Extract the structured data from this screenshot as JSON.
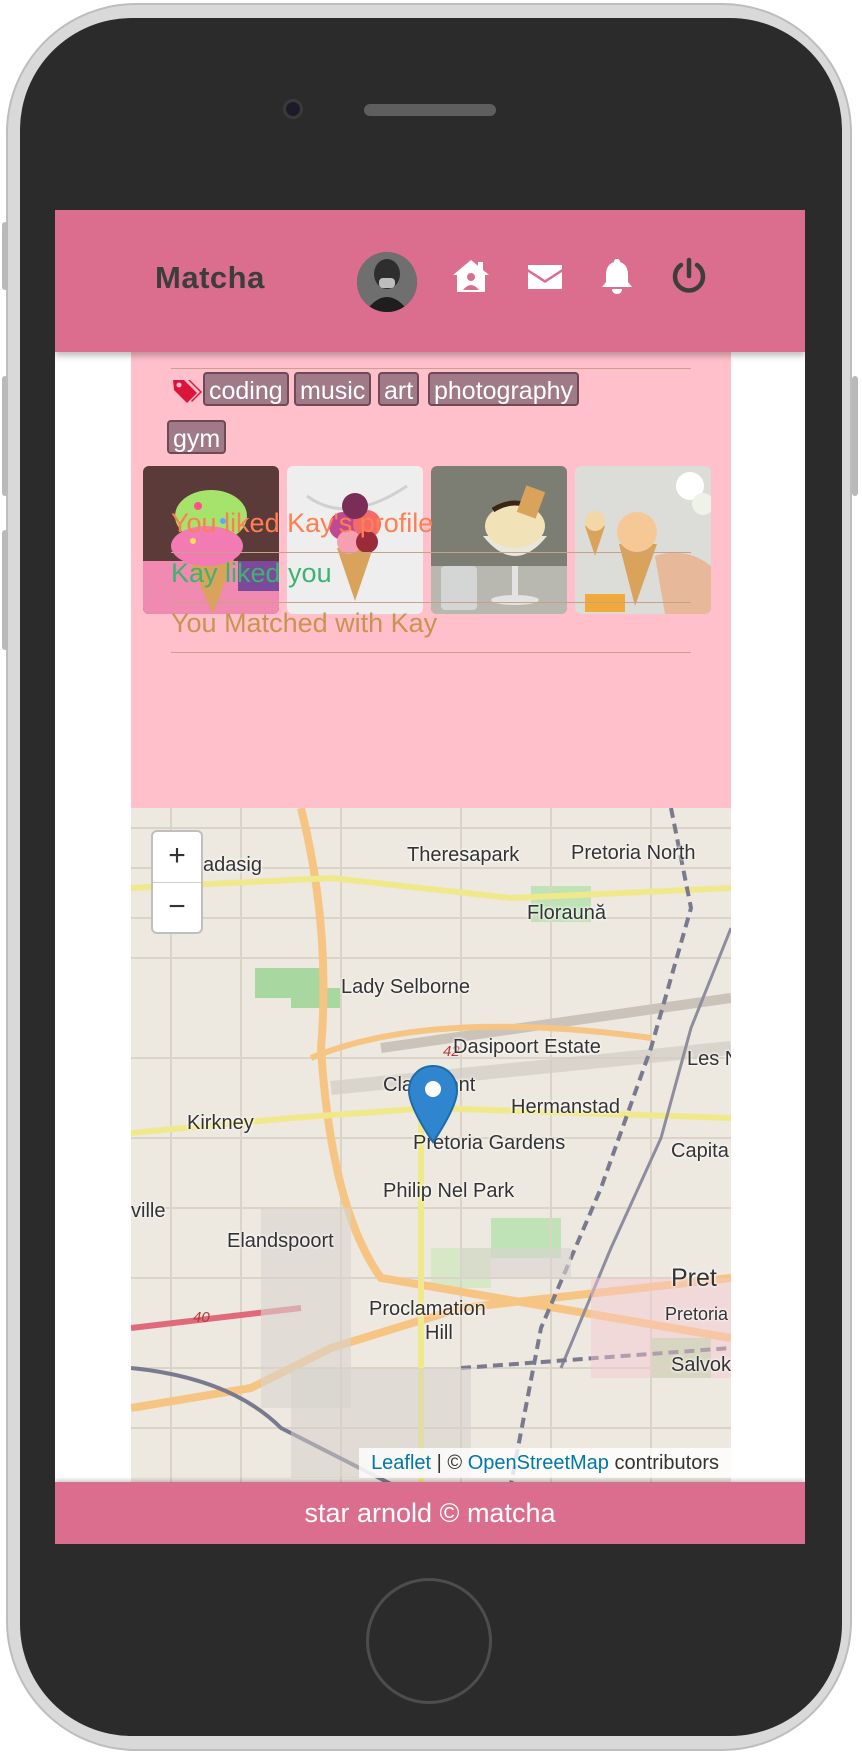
{
  "app": {
    "title": "Matcha"
  },
  "nav": {
    "avatar_icon": "avatar",
    "icons": [
      "home-icon",
      "envelope-icon",
      "bell-icon",
      "power-icon"
    ]
  },
  "profile": {
    "tags": [
      "coding",
      "music",
      "art",
      "photography",
      "gym"
    ],
    "photos": [
      "ice-cream-cone-pink-green",
      "ice-cream-cone-berry",
      "ice-cream-sundae-glass",
      "ice-cream-cone-hand"
    ],
    "status": [
      {
        "text": "You liked Kay's profile",
        "color": "#ff7f50"
      },
      {
        "text": "Kay liked you",
        "color": "#3cb371"
      },
      {
        "text": "You Matched with Kay",
        "color": "#c8944f"
      }
    ]
  },
  "map": {
    "zoom_in": "+",
    "zoom_out": "−",
    "places": [
      "Theresapark",
      "Pretoria North",
      "Floraună",
      "Lady Selborne",
      "Dasipoort Estate",
      "Claremont",
      "Hermanstad",
      "Kirkney",
      "Pretoria Gardens",
      "Capita",
      "Philip Nel Park",
      "Elandspoort",
      "Proclamation",
      "Hill",
      "Pretoria",
      "Salvok",
      "Les N",
      "ville",
      "adasig",
      "Pret"
    ],
    "route_labels": [
      "42",
      "40"
    ],
    "attribution": {
      "leaflet": "Leaflet",
      "separator": " | © ",
      "osm": "OpenStreetMap",
      "suffix": " contributors"
    }
  },
  "footer": {
    "text": "star arnold © matcha"
  },
  "colors": {
    "brand": "#db6e8f",
    "card": "#ffc0cb",
    "tag": "#a07b87"
  }
}
